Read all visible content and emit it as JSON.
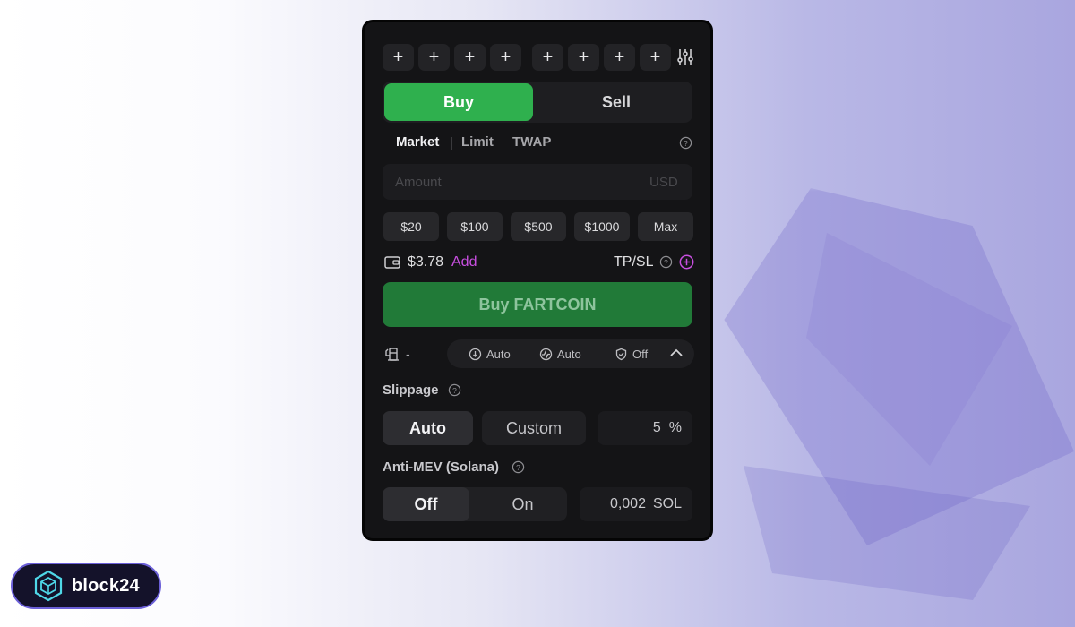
{
  "quick_buttons": [
    "+",
    "+",
    "+",
    "+",
    "+",
    "+",
    "+",
    "+"
  ],
  "trade_tabs": {
    "buy": "Buy",
    "sell": "Sell"
  },
  "order_types": [
    "Market",
    "Limit",
    "TWAP"
  ],
  "amount": {
    "placeholder": "Amount",
    "unit": "USD"
  },
  "presets": [
    "$20",
    "$100",
    "$500",
    "$1000",
    "Max"
  ],
  "wallet": {
    "balance": "$3.78",
    "add_label": "Add"
  },
  "tpsl_label": "TP/SL",
  "buy_button": "Buy FARTCOIN",
  "fee_value": "-",
  "settings_pill": [
    {
      "icon": "priority-fee-icon",
      "label": "Auto"
    },
    {
      "icon": "slippage-icon",
      "label": "Auto"
    },
    {
      "icon": "shield-icon",
      "label": "Off"
    }
  ],
  "slippage": {
    "label": "Slippage",
    "auto": "Auto",
    "custom": "Custom",
    "value": "5",
    "unit": "%"
  },
  "anti_mev": {
    "label": "Anti-MEV (Solana)",
    "off": "Off",
    "on": "On",
    "value": "0,002",
    "unit": "SOL"
  },
  "brand": {
    "name": "block24"
  },
  "colors": {
    "buy_green": "#2fb04e",
    "buy_button": "#217a38",
    "accent_purple": "#c84fe0"
  }
}
